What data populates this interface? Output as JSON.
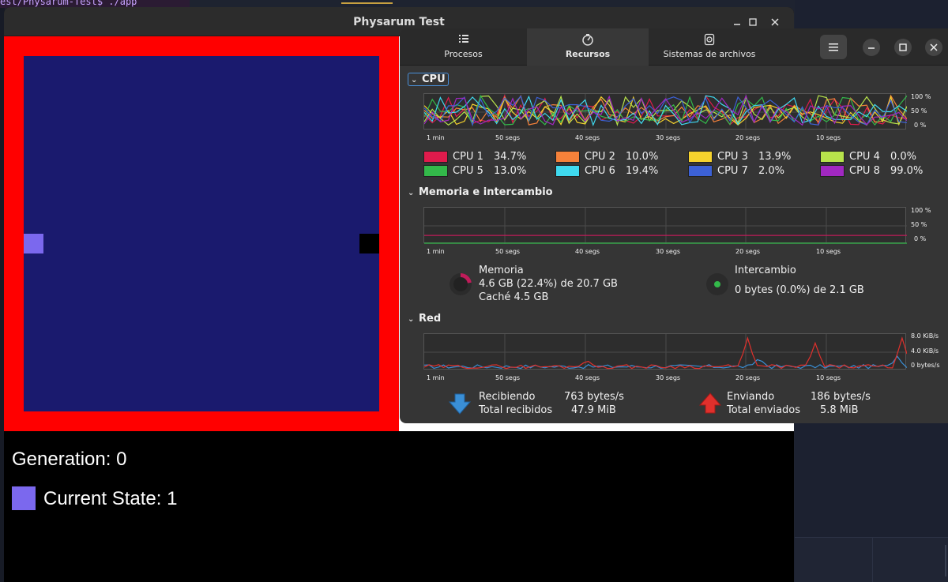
{
  "background": {
    "terminal_text": "est/Physarum-Test$ ./app"
  },
  "physarum": {
    "title": "Physarum Test",
    "generation_label": "Generation: 0",
    "state_label": "Current State: 1",
    "colors": {
      "border": "#ff0000",
      "grid": "#1a1a6e",
      "state_1": "#7b68ee",
      "state_0": "#000000"
    }
  },
  "sysmon": {
    "tabs": [
      {
        "label": "Procesos",
        "icon": "list-icon"
      },
      {
        "label": "Recursos",
        "icon": "gauge-icon"
      },
      {
        "label": "Sistemas de archivos",
        "icon": "disk-icon"
      }
    ],
    "active_tab": "Recursos",
    "cpu": {
      "heading": "CPU",
      "x_labels": [
        "1 min",
        "50 segs",
        "40 segs",
        "30 segs",
        "20 segs",
        "10 segs"
      ],
      "y_labels": [
        "100 %",
        "50 %",
        "0 %"
      ],
      "cores": [
        {
          "name": "CPU 1",
          "value": "34.7%",
          "color": "#e01b4c"
        },
        {
          "name": "CPU 2",
          "value": "10.0%",
          "color": "#f5813a"
        },
        {
          "name": "CPU 3",
          "value": "13.9%",
          "color": "#f6d32d"
        },
        {
          "name": "CPU 4",
          "value": "0.0%",
          "color": "#b7e34b"
        },
        {
          "name": "CPU 5",
          "value": "13.0%",
          "color": "#33b94a"
        },
        {
          "name": "CPU 6",
          "value": "19.4%",
          "color": "#3fd9ef"
        },
        {
          "name": "CPU 7",
          "value": "2.0%",
          "color": "#3c61d6"
        },
        {
          "name": "CPU 8",
          "value": "99.0%",
          "color": "#a128c1"
        }
      ]
    },
    "memory": {
      "heading": "Memoria e intercambio",
      "x_labels": [
        "1 min",
        "50 segs",
        "40 segs",
        "30 segs",
        "20 segs",
        "10 segs"
      ],
      "y_labels": [
        "100 %",
        "50 %",
        "0 %"
      ],
      "mem_title": "Memoria",
      "mem_usage": "4.6 GB (22.4%) de 20.7 GB",
      "mem_cache": "Caché 4.5 GB",
      "swap_title": "Intercambio",
      "swap_usage": "0 bytes (0.0%) de 2.1 GB",
      "mem_fraction": 0.224,
      "swap_fraction": 0.0,
      "mem_color": "#c01c5a",
      "swap_color": "#33b94a"
    },
    "network": {
      "heading": "Red",
      "x_labels": [
        "1 min",
        "50 segs",
        "40 segs",
        "30 segs",
        "20 segs",
        "10 segs"
      ],
      "y_labels": [
        "8.0 KiB/s",
        "4.0 KiB/s",
        "0 bytes/s"
      ],
      "recv_label": "Recibiendo",
      "recv_rate": "763 bytes/s",
      "recv_total_label": "Total recibidos",
      "recv_total": "47.9 MiB",
      "send_label": "Enviando",
      "send_rate": "186 bytes/s",
      "send_total_label": "Total enviados",
      "send_total": "5.8 MiB",
      "recv_color": "#3a8fd6",
      "send_color": "#e0302c"
    }
  }
}
